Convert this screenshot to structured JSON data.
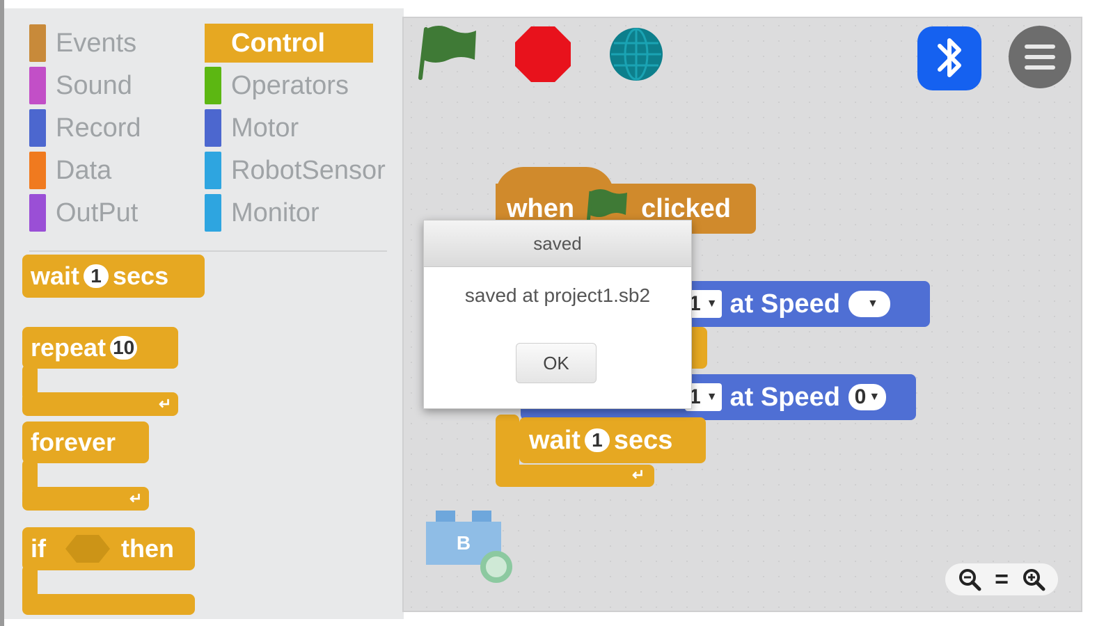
{
  "categories_left": [
    {
      "label": "Events",
      "color": "#c88a3a"
    },
    {
      "label": "Sound",
      "color": "#c24fc7"
    },
    {
      "label": "Record",
      "color": "#4c67cf"
    },
    {
      "label": "Data",
      "color": "#f07a1f"
    },
    {
      "label": "OutPut",
      "color": "#9a4fd6"
    }
  ],
  "categories_right": [
    {
      "label": "Control",
      "color": "#e6a822",
      "active": true
    },
    {
      "label": "Operators",
      "color": "#5cb712"
    },
    {
      "label": "Motor",
      "color": "#4c67cf"
    },
    {
      "label": "RobotSensor",
      "color": "#2ea5e0"
    },
    {
      "label": "Monitor",
      "color": "#2ea5e0"
    }
  ],
  "palette_blocks": {
    "wait": {
      "pre": "wait",
      "value": "1",
      "post": "secs"
    },
    "repeat": {
      "pre": "repeat",
      "value": "10"
    },
    "forever": {
      "label": "forever"
    },
    "if_then": {
      "pre": "if",
      "post": "then"
    }
  },
  "script": {
    "hat": {
      "pre": "when",
      "post": "clicked"
    },
    "motor1": {
      "port": "1",
      "label": "at Speed",
      "speed": ""
    },
    "motor2": {
      "port": "1",
      "label": "at Speed",
      "speed": "0"
    },
    "wait": {
      "pre": "wait",
      "value": "1",
      "post": "secs"
    },
    "sprite_label": "B"
  },
  "dialog": {
    "title": "saved",
    "message": "saved at project1.sb2",
    "ok_label": "OK"
  },
  "toolbar": {
    "zoom_reset_label": "="
  },
  "colors": {
    "control": "#e6a822",
    "events": "#d08a2c",
    "motor": "#4f6fd4",
    "bluetooth": "#1561f0",
    "stop": "#e8121c",
    "flag": "#3f7a36",
    "globe": "#0d7f8c"
  }
}
